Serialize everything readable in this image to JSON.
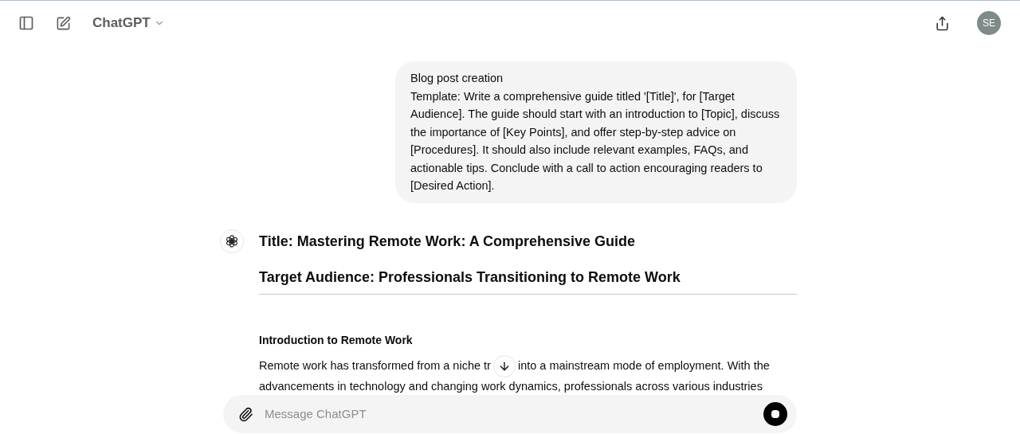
{
  "header": {
    "model": "ChatGPT",
    "avatar": "SE"
  },
  "user_message": {
    "lines": [
      "Blog post creation",
      "Template: Write a comprehensive guide titled '[Title]', for [Target Audience]. The guide should start with an introduction to [Topic], discuss the importance of [Key Points], and offer step-by-step advice on [Procedures]. It should also include relevant examples, FAQs, and actionable tips. Conclude with a call to action encouraging readers to [Desired Action]."
    ]
  },
  "assistant_message": {
    "headings": [
      "Title: Mastering Remote Work: A Comprehensive Guide",
      "Target Audience: Professionals Transitioning to Remote Work"
    ],
    "section_title": "Introduction to Remote Work",
    "paragraph_lines": [
      "Remote work has transformed from a niche tr",
      "into a mainstream mode of employment. With the",
      "advancements in technology and changing work dynamics, professionals across various industries"
    ]
  },
  "composer": {
    "placeholder": "Message ChatGPT",
    "generating": true
  }
}
